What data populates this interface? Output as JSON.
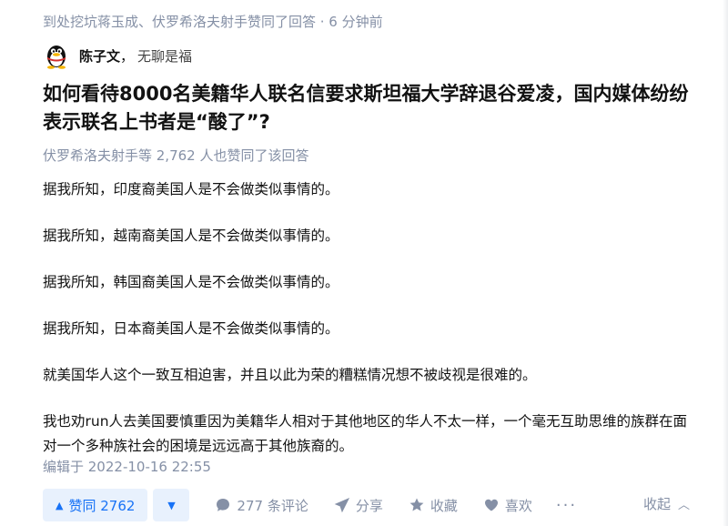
{
  "activity": "到处挖坑蒋玉成、伏罗希洛夫射手赞同了回答 · 6 分钟前",
  "author": {
    "name": "陈子文",
    "separator": "，",
    "bio": "无聊是福"
  },
  "question": {
    "title": "如何看待8000名美籍华人联名信要求斯坦福大学辞退谷爱凌，国内媒体纷纷表示联名上书者是“酸了”?"
  },
  "votes_line": "伏罗希洛夫射手等 2,762 人也赞同了该回答",
  "content": [
    "据我所知，印度裔美国人是不会做类似事情的。",
    "据我所知，越南裔美国人是不会做类似事情的。",
    "据我所知，韩国裔美国人是不会做类似事情的。",
    "据我所知，日本裔美国人是不会做类似事情的。",
    "就美国华人这个一致互相迫害，并且以此为荣的糟糕情况想不被歧视是很难的。",
    "我也劝run人去美国要慎重因为美籍华人相对于其他地区的华人不太一样，一个毫无互助思维的族群在面对一个多种族社会的困境是远远高于其他族裔的。"
  ],
  "edited": "编辑于 2022-10-16 22:55",
  "actions": {
    "vote_up": "赞同 2762",
    "vote_up_icon": "triangle-up",
    "vote_down_icon": "triangle-down",
    "comments": "277 条评论",
    "share": "分享",
    "favorite": "收藏",
    "like": "喜欢",
    "more": "···",
    "collapse": "收起"
  },
  "colors": {
    "accent": "#1772f6",
    "accent_bg": "#e8f1fd",
    "muted": "#8590a6",
    "text": "#121212"
  }
}
